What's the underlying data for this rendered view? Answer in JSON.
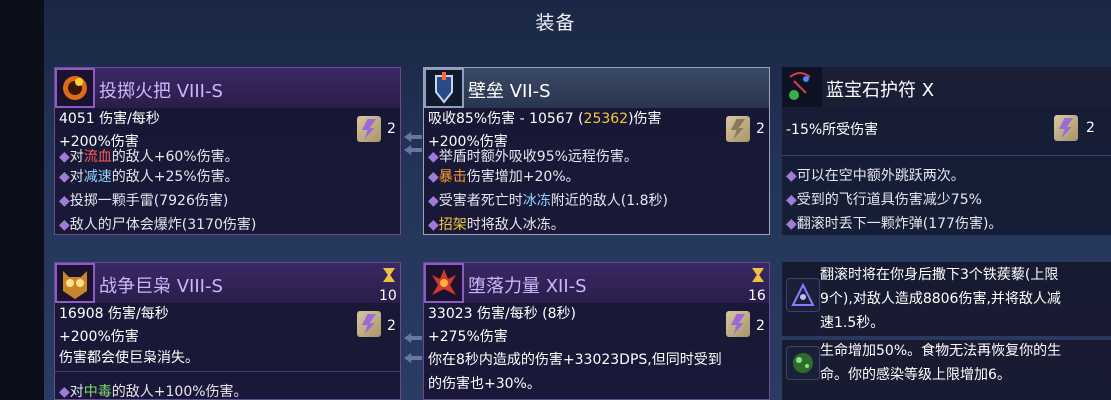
{
  "screen_title": "装备",
  "cards": [
    {
      "name": "投掷火把 VIII-S",
      "line1": "4051 伤害/每秒",
      "line2": "+200%伤害",
      "scroll_count": "2",
      "traits": [
        {
          "pre": "对",
          "hl": "流血",
          "post": "的敌人+60%伤害。",
          "cls": "hl-red"
        },
        {
          "pre": "对",
          "hl": "减速",
          "post": "的敌人+25%伤害。",
          "cls": "hl-cyan"
        },
        {
          "pre": "",
          "hl": "",
          "post": "投掷一颗手雷(7926伤害)",
          "cls": ""
        },
        {
          "pre": "",
          "hl": "",
          "post": "敌人的尸体会爆炸(3170伤害)",
          "cls": ""
        }
      ]
    },
    {
      "name": "壁垒 VII-S",
      "line1_a": "吸收85%伤害 - 10567 (",
      "line1_b": "25362",
      "line1_c": ")伤害",
      "line2": "+200%伤害",
      "scroll_count": "2",
      "traits": [
        {
          "pre": "",
          "hl": "",
          "post": "举盾时额外吸收95%远程伤害。",
          "cls": ""
        },
        {
          "pre": "",
          "hl": "暴击",
          "post": "伤害增加+20%。",
          "cls": "hl-orange"
        },
        {
          "pre": "受害者死亡时",
          "hl": "冰冻",
          "post": "附近的敌人(1.8秒)",
          "cls": "hl-cyan"
        },
        {
          "pre": "",
          "hl": "招架",
          "post": "时将敌人冰冻。",
          "cls": "hl-yellow"
        }
      ]
    },
    {
      "name": "蓝宝石护符 X",
      "line1": "-15%所受伤害",
      "scroll_count": "2",
      "traits": [
        {
          "pre": "",
          "hl": "",
          "post": "可以在空中额外跳跃两次。",
          "cls": ""
        },
        {
          "pre": "",
          "hl": "",
          "post": "受到的飞行道具伤害减少75%",
          "cls": ""
        },
        {
          "pre": "",
          "hl": "",
          "post": "翻滚时丢下一颗炸弹(177伤害)。",
          "cls": ""
        }
      ]
    },
    {
      "name": "战争巨枭 VIII-S",
      "line1": "16908 伤害/每秒",
      "line2": "+200%伤害",
      "cooldown": "10",
      "scroll_count": "2",
      "desc": "伤害都会使巨枭消失。",
      "traits": [
        {
          "pre": "对",
          "hl": "中毒",
          "post": "的敌人+100%伤害。",
          "cls": "hl-green"
        }
      ]
    },
    {
      "name": "堕落力量 XII-S",
      "line1": "33023 伤害/每秒 (8秒)",
      "line2": "+275%伤害",
      "cooldown": "16",
      "scroll_count": "2",
      "desc1": "你在8秒内造成的伤害+33023DPS,但同时受到",
      "desc2": "的伤害也+30%。"
    }
  ],
  "passives": [
    {
      "lines": [
        "翻滚时将在你身后撒下3个铁蒺藜(上限",
        "9个),对敌人造成8806伤害,并将敌人减",
        "速1.5秒。"
      ]
    },
    {
      "lines": [
        "生命增加50%。食物无法再恢复你的生",
        "命。你的感染等级上限增加6。"
      ]
    }
  ]
}
